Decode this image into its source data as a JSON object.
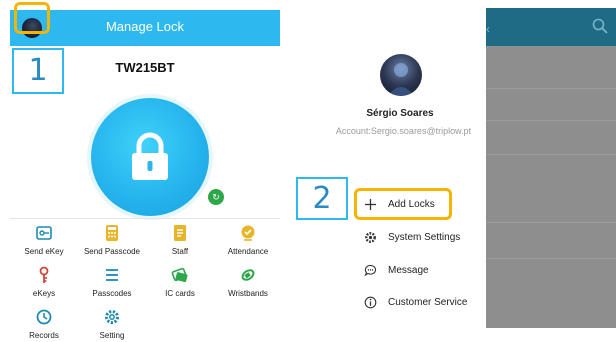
{
  "left_screen": {
    "header_title": "Manage Lock",
    "step_label": "1",
    "lock_name": "TW215BT",
    "grid": [
      {
        "label": "Send eKey",
        "icon": "ekey-icon"
      },
      {
        "label": "Send Passcode",
        "icon": "passcode-icon"
      },
      {
        "label": "Staff",
        "icon": "staff-icon"
      },
      {
        "label": "Attendance",
        "icon": "attendance-icon"
      },
      {
        "label": "eKeys",
        "icon": "ekeys-icon"
      },
      {
        "label": "Passcodes",
        "icon": "passcodes-icon"
      },
      {
        "label": "IC cards",
        "icon": "ic-cards-icon"
      },
      {
        "label": "Wristbands",
        "icon": "wristbands-icon"
      },
      {
        "label": "Records",
        "icon": "records-icon"
      },
      {
        "label": "Setting",
        "icon": "setting-icon"
      }
    ]
  },
  "drawer": {
    "user_name": "Sérgio Soares",
    "account": "Account:Sergio.soares@triplow.pt",
    "step_label": "2",
    "menu": [
      {
        "label": "Add Locks",
        "icon": "plus-icon"
      },
      {
        "label": "System Settings",
        "icon": "gear-icon"
      },
      {
        "label": "Message",
        "icon": "message-icon"
      },
      {
        "label": "Customer Service",
        "icon": "info-icon"
      }
    ]
  },
  "colors": {
    "header_blue": "#2eb8f0",
    "highlight_yellow": "#f4b400",
    "overlay_gray": "#8e8e8e",
    "icon_yellow": "#e8b52a",
    "icon_teal": "#1e8ab0"
  }
}
